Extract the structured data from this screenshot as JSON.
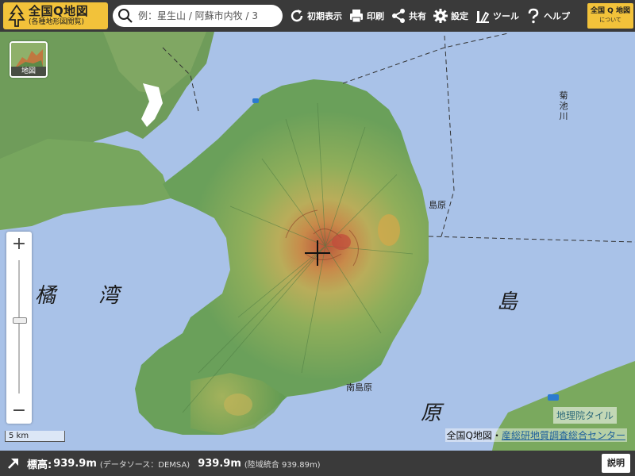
{
  "header": {
    "logo_title": "全国Q地図",
    "logo_subtitle": "(各種地形図閲覧)",
    "search_placeholder": "例：星生山 / 阿蘇市内牧 / 3",
    "buttons": {
      "reset": "初期表示",
      "print": "印刷",
      "share": "共有",
      "settings": "設定",
      "tools": "ツール",
      "help": "ヘルプ"
    },
    "about_title": "全国 Q 地図",
    "about_subtitle": "について"
  },
  "map": {
    "layer_button_label": "地図",
    "labels": {
      "bay_left": "橘",
      "bay_right": "湾",
      "shima": "島",
      "hara": "原",
      "river": "菊池川",
      "town_east": "島原",
      "town_south": "南島原"
    },
    "scale": "5 km",
    "tile_credit": "地理院タイル",
    "attribution_prefix": "全国Q地図・",
    "attribution_link": "産総研地質調査総合センター"
  },
  "footer": {
    "elevation_label": "標高:",
    "elevation_value": "939.9m",
    "source": "(データソース：DEMSA)",
    "elevation_value2": "939.9m",
    "source2": "(陸域統合 939.89m)",
    "explain_button": "説明"
  },
  "colors": {
    "topbar": "#3a3a3a",
    "accent_yellow": "#f2c23a",
    "sea": "#a9c2e8"
  }
}
